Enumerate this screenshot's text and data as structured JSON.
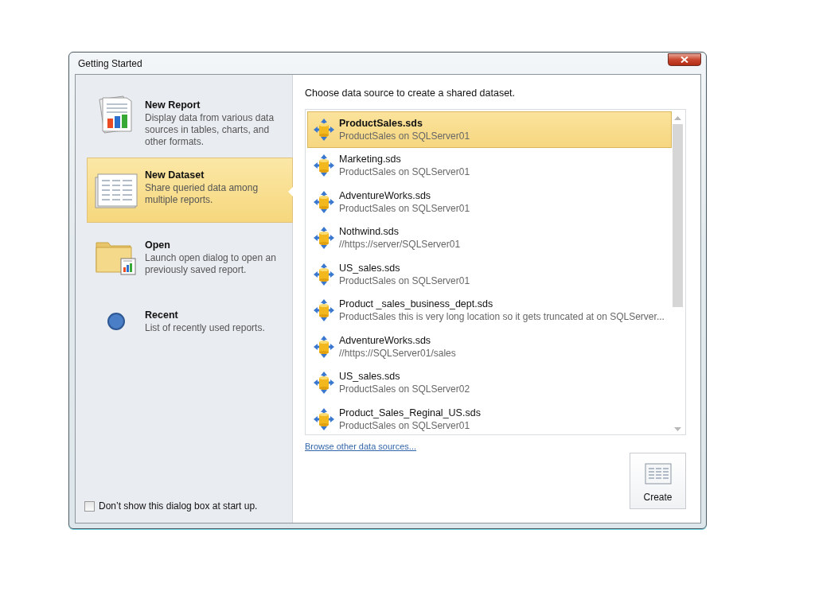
{
  "window": {
    "title": "Getting Started"
  },
  "actions": [
    {
      "kind": "report",
      "title": "New Report",
      "description": "Display data from various data sources in tables, charts, and other formats.",
      "selected": false
    },
    {
      "kind": "dataset",
      "title": "New Dataset",
      "description": "Share queried data among multiple reports.",
      "selected": true
    },
    {
      "kind": "open",
      "title": "Open",
      "description": "Launch open dialog to open an previously saved report.",
      "selected": false
    },
    {
      "kind": "recent",
      "title": "Recent",
      "description": "List of recently used reports.",
      "selected": false
    }
  ],
  "dont_show": {
    "label": "Don’t show this dialog box at start up.",
    "checked": false
  },
  "prompt": "Choose data source to create a shared dataset.",
  "data_sources": [
    {
      "name": "ProductSales.sds",
      "location": "ProductSales on SQLServer01",
      "selected": true
    },
    {
      "name": "Marketing.sds",
      "location": "ProductSales on SQLServer01",
      "selected": false
    },
    {
      "name": "AdventureWorks.sds",
      "location": "ProductSales on SQLServer01",
      "selected": false
    },
    {
      "name": "Nothwind.sds",
      "location": "//https://server/SQLServer01",
      "selected": false
    },
    {
      "name": "US_sales.sds",
      "location": "ProductSales on SQLServer01",
      "selected": false
    },
    {
      "name": "Product _sales_business_dept.sds",
      "location": "ProductSales this is very long location so it gets truncated at on SQLServer...",
      "selected": false
    },
    {
      "name": "AdventureWorks.sds",
      "location": "//https://SQLServer01/sales",
      "selected": false
    },
    {
      "name": "US_sales.sds",
      "location": "ProductSales on SQLServer02",
      "selected": false
    },
    {
      "name": "Product_Sales_Reginal_US.sds",
      "location": "ProductSales on SQLServer01",
      "selected": false
    }
  ],
  "browse_link": "Browse other data sources...",
  "create_button": "Create"
}
